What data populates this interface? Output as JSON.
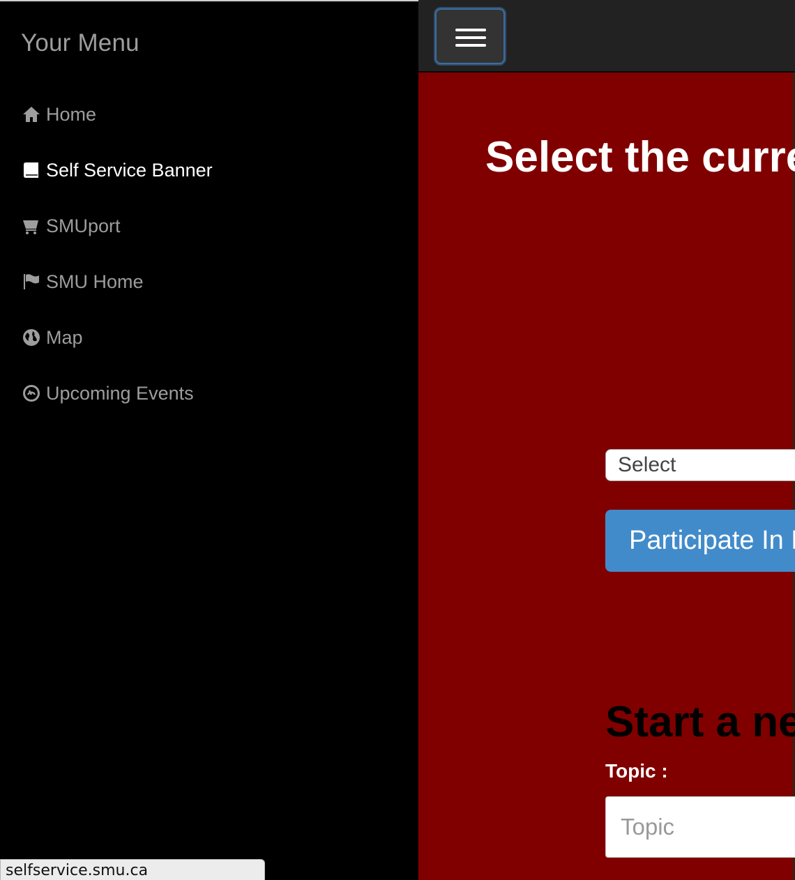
{
  "sidebar": {
    "title": "Your Menu",
    "items": [
      {
        "label": "Home",
        "icon": "home-icon",
        "active": false
      },
      {
        "label": "Self Service Banner",
        "icon": "book-icon",
        "active": true
      },
      {
        "label": "SMUport",
        "icon": "shopping-cart-icon",
        "active": false
      },
      {
        "label": "SMU Home",
        "icon": "flag-icon",
        "active": false
      },
      {
        "label": "Map",
        "icon": "globe-icon",
        "active": false
      },
      {
        "label": "Upcoming Events",
        "icon": "dashboard-icon",
        "active": false
      }
    ]
  },
  "navbar": {
    "toggle_icon": "hamburger-icon"
  },
  "main": {
    "headline": "Select the curre",
    "select": {
      "value": "Select"
    },
    "participate_button": "Participate In D",
    "new_section_heading": "Start a ne",
    "topic_label": "Topic :",
    "topic_placeholder": "Topic"
  },
  "status": {
    "url": "selfservice.smu.ca"
  },
  "colors": {
    "sidebar_bg": "#000000",
    "menu_text": "#9d9d9d",
    "menu_active_text": "#ffffff",
    "navbar_bg": "#222222",
    "main_bg": "#800000",
    "button_blue": "#428bca"
  }
}
